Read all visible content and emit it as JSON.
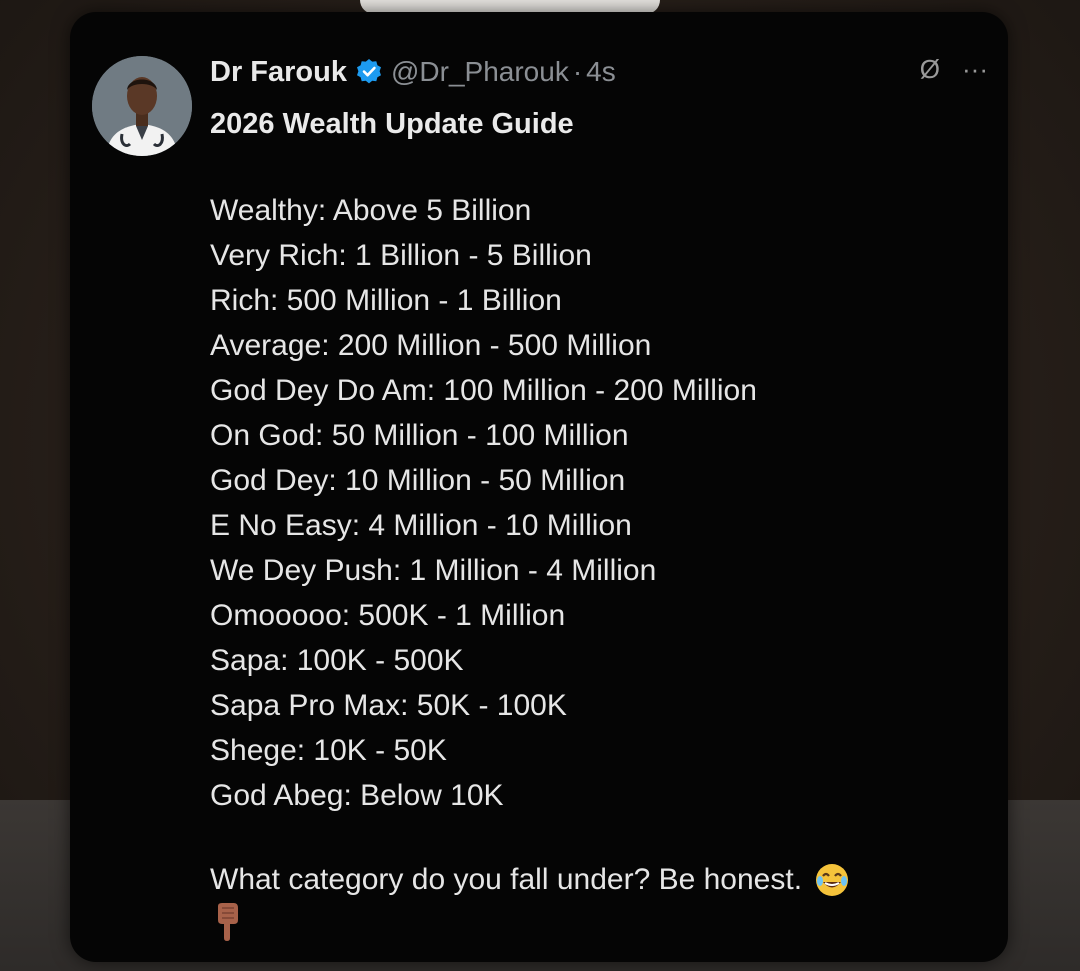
{
  "post": {
    "author_name": "Dr Farouk",
    "handle": "@Dr_Pharouk",
    "separator": "·",
    "time": "4s",
    "title": "2026 Wealth Update Guide",
    "tiers": [
      "Wealthy: Above 5 Billion",
      "Very Rich: 1 Billion - 5 Billion",
      "Rich: 500 Million - 1 Billion",
      "Average: 200 Million - 500 Million",
      "God Dey Do Am: 100 Million - 200 Million",
      "On God: 50 Million - 100 Million",
      "God Dey: 10 Million - 50 Million",
      "E No Easy: 4 Million - 10 Million",
      "We Dey Push: 1 Million - 4 Million",
      "Omooooo: 500K - 1 Million",
      "Sapa: 100K - 500K",
      "Sapa Pro Max: 50K - 100K",
      "Shege: 10K - 50K",
      "God Abeg: Below 10K"
    ],
    "question": "What category do you fall under? Be honest.",
    "more_label": "···",
    "grok_label": "Ø"
  },
  "icons": {
    "verified": "verified-badge-icon",
    "grok": "grok-icon",
    "more": "more-icon",
    "laugh": "tears-of-joy-emoji",
    "point": "pointing-down-emoji"
  },
  "colors": {
    "card_bg": "#050505",
    "text": "#e6e6e6",
    "muted": "#8b8f94",
    "verified": "#1d9bf0"
  }
}
